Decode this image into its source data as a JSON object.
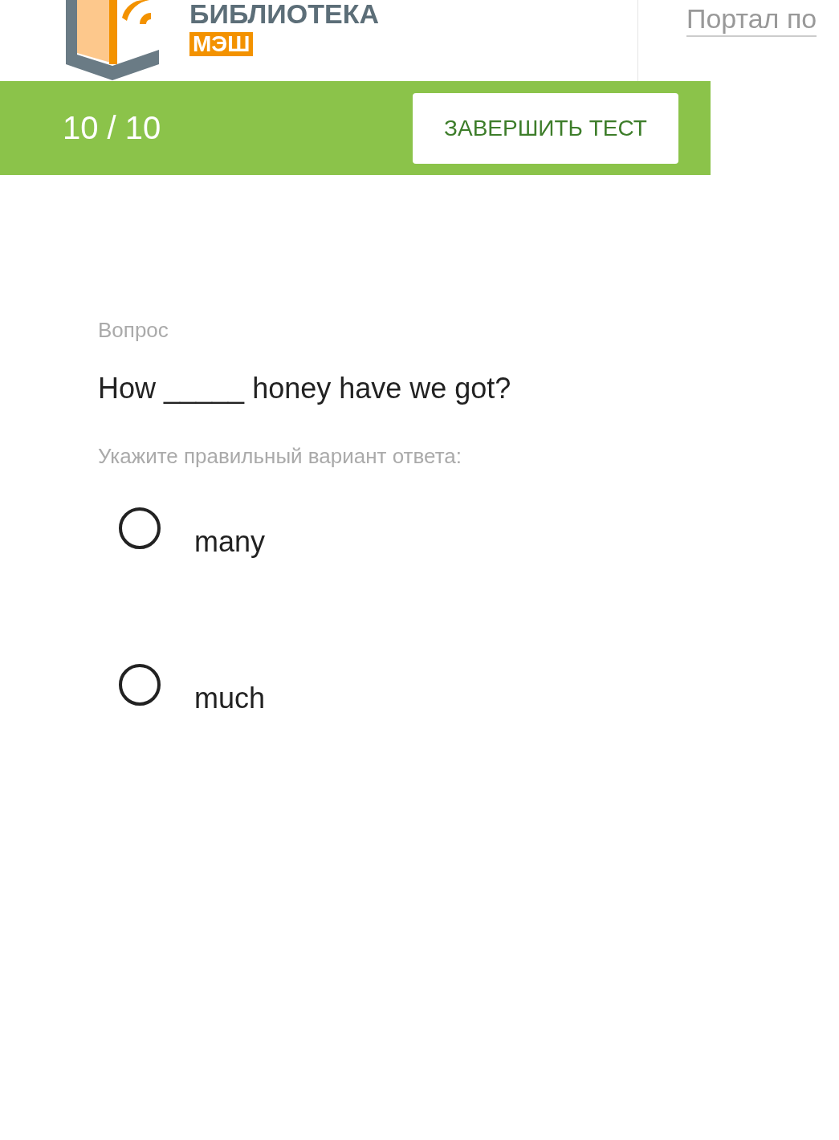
{
  "header": {
    "logo_title": "БИБЛИОТЕКА",
    "logo_badge": "МЭШ",
    "portal_link": "Портал по"
  },
  "test_bar": {
    "progress": "10 / 10",
    "finish_button": "ЗАВЕРШИТЬ ТЕСТ"
  },
  "question": {
    "label": "Вопрос",
    "text": "How _____ honey have we got?",
    "instruction": "Укажите правильный вариант ответа:",
    "options": [
      {
        "label": "many",
        "selected": false
      },
      {
        "label": "much",
        "selected": false
      }
    ]
  }
}
